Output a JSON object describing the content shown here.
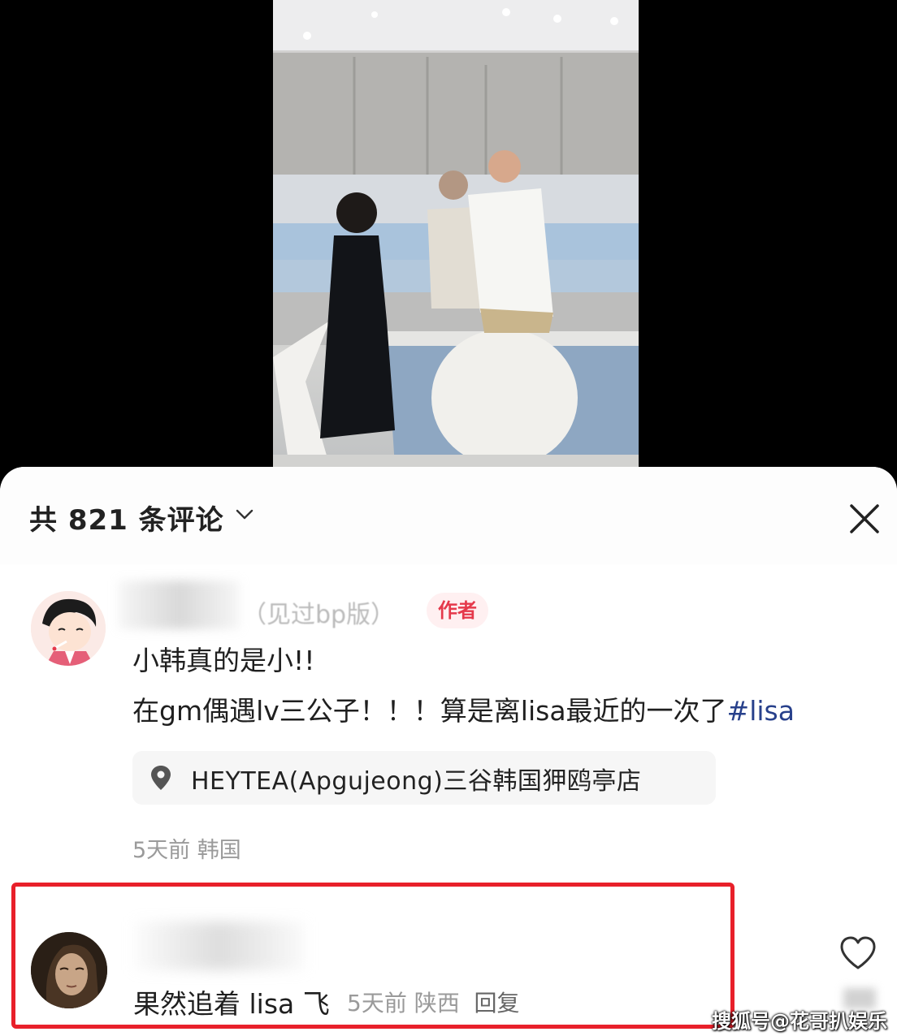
{
  "header": {
    "comment_count_label": "共 821 条评论"
  },
  "author_comment": {
    "name_suffix": "（见过bp版）",
    "badge": "作者",
    "line1": "小韩真的是小!!",
    "line2_main": "在gm偶遇lv三公子！！！算是离lisa最近的一次了",
    "line2_hashtag": "#lisa",
    "location": "HEYTEA(Apgujeong)三谷韩国狎鸥亭店",
    "meta": "5天前  韩国"
  },
  "reply_comment": {
    "text": "果然追着 lisa 飞",
    "meta_time": "5天前  陕西",
    "reply_label": "回复"
  },
  "watermark": "搜狐号@花哥扒娱乐",
  "colors": {
    "badge_red": "#e5394b",
    "highlight_border": "#e8202a",
    "hashtag_blue": "#27408b"
  },
  "icons": [
    "chevron-down-icon",
    "close-icon",
    "location-pin-icon",
    "heart-icon"
  ]
}
